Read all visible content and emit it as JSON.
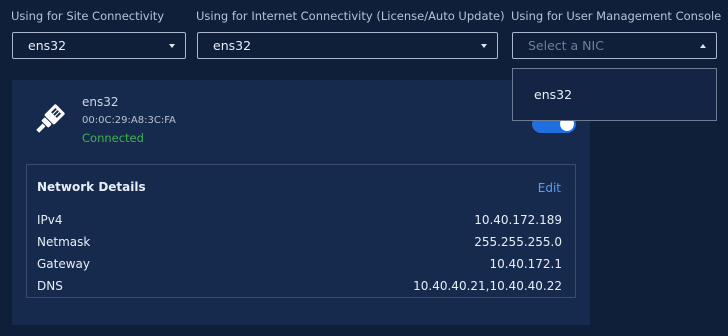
{
  "selectors": [
    {
      "label": "Using for Site Connectivity",
      "value": "ens32"
    },
    {
      "label": "Using for Internet Connectivity (License/Auto Update)",
      "value": "ens32"
    },
    {
      "label": "Using for User Management Console",
      "placeholder": "Select a NIC"
    }
  ],
  "dropdown": {
    "options": [
      "ens32"
    ]
  },
  "nic": {
    "name": "ens32",
    "mac": "00:0C:29:A8:3C:FA",
    "status": "Connected",
    "enabled": true,
    "icon": "ethernet-plug-icon"
  },
  "details": {
    "title": "Network Details",
    "edit_label": "Edit",
    "rows": [
      {
        "key": "IPv4",
        "value": "10.40.172.189"
      },
      {
        "key": "Netmask",
        "value": "255.255.255.0"
      },
      {
        "key": "Gateway",
        "value": "10.40.172.1"
      },
      {
        "key": "DNS",
        "value": "10.40.40.21,10.40.40.22"
      }
    ]
  },
  "colors": {
    "background": "#0f1f3a",
    "card": "#162a4e",
    "accent": "#1f6fe0",
    "link": "#5a9cf0",
    "connected": "#3fb24f"
  }
}
